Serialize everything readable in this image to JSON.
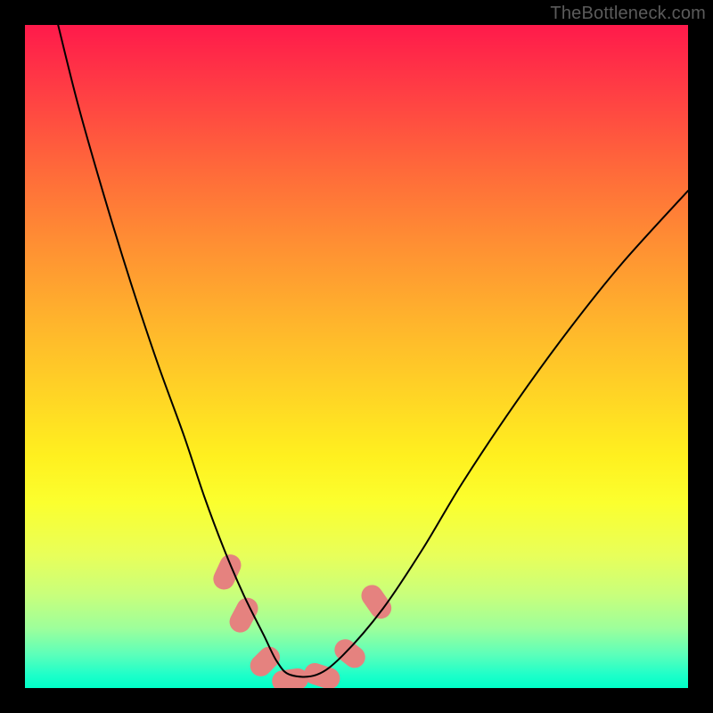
{
  "watermark": {
    "text": "TheBottleneck.com"
  },
  "chart_data": {
    "type": "line",
    "title": "",
    "xlabel": "",
    "ylabel": "",
    "xlim": [
      0,
      100
    ],
    "ylim": [
      0,
      100
    ],
    "grid": false,
    "legend": null,
    "background": {
      "gradient_stops": [
        {
          "pos": 0.0,
          "color": "#ff1a4b"
        },
        {
          "pos": 0.5,
          "color": "#ffd525"
        },
        {
          "pos": 0.72,
          "color": "#fbff2e"
        },
        {
          "pos": 1.0,
          "color": "#00ffc8"
        }
      ],
      "meaning": "top = high bottleneck, bottom = no bottleneck"
    },
    "series": [
      {
        "name": "bottleneck-curve",
        "color": "#000000",
        "x": [
          5,
          8,
          12,
          16,
          20,
          24,
          27,
          30,
          33,
          36,
          38,
          40,
          44,
          48,
          54,
          60,
          66,
          74,
          82,
          90,
          100
        ],
        "y": [
          100,
          88,
          74,
          61,
          49,
          38,
          29,
          21,
          14,
          8,
          4,
          2,
          2,
          5,
          12,
          21,
          31,
          43,
          54,
          64,
          75
        ]
      }
    ],
    "markers": [
      {
        "name": "highlight-segments",
        "color": "#e5827f",
        "shape": "rounded-capsule",
        "points": [
          {
            "x": 30.5,
            "y": 17.5,
            "angle_deg": 65,
            "len": 5.5
          },
          {
            "x": 33.0,
            "y": 11.0,
            "angle_deg": 62,
            "len": 5.5
          },
          {
            "x": 36.2,
            "y": 4.0,
            "angle_deg": 45,
            "len": 5.0
          },
          {
            "x": 40.0,
            "y": 1.2,
            "angle_deg": 8,
            "len": 5.5
          },
          {
            "x": 44.8,
            "y": 1.8,
            "angle_deg": -18,
            "len": 5.5
          },
          {
            "x": 49.0,
            "y": 5.2,
            "angle_deg": -38,
            "len": 5.0
          },
          {
            "x": 53.0,
            "y": 13.0,
            "angle_deg": -55,
            "len": 5.5
          }
        ]
      }
    ]
  }
}
